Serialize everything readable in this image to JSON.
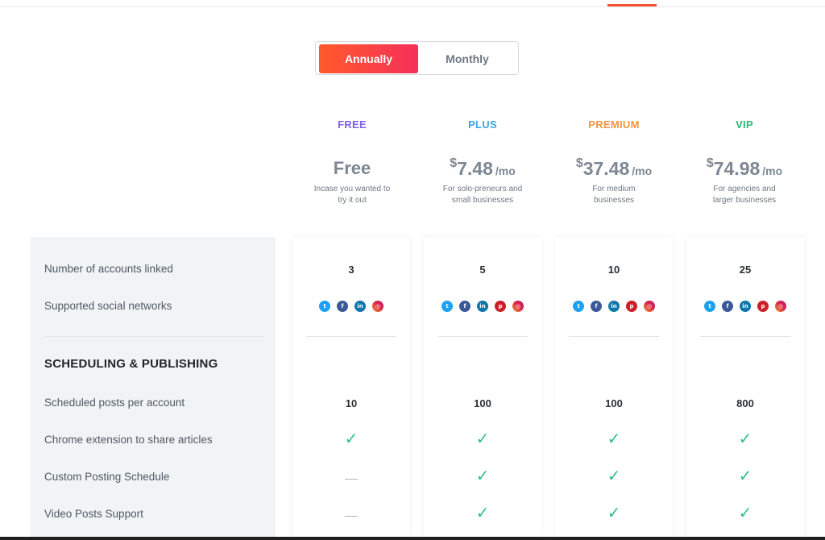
{
  "billing_toggle": {
    "annually": "Annually",
    "monthly": "Monthly",
    "selected": "Annually"
  },
  "colors": {
    "free": "#7b61e8",
    "plus": "#3aa6e8",
    "premium": "#f4943b",
    "vip": "#27bd74",
    "accent": "#f4502f",
    "check": "#2fbf8c"
  },
  "plans": [
    {
      "name": "FREE",
      "price_text": "Free",
      "description": [
        "Incase you wanted to",
        "try it out"
      ]
    },
    {
      "name": "PLUS",
      "currency": "$",
      "amount": "7.48",
      "per": "/mo",
      "description": [
        "For solo-preneurs and",
        "small businesses"
      ]
    },
    {
      "name": "PREMIUM",
      "currency": "$",
      "amount": "37.48",
      "per": "/mo",
      "description": [
        "For medium",
        "businesses"
      ]
    },
    {
      "name": "VIP",
      "currency": "$",
      "amount": "74.98",
      "per": "/mo",
      "description": [
        "For agencies and",
        "larger businesses"
      ]
    }
  ],
  "features": {
    "accounts_linked": {
      "label": "Number of accounts linked",
      "values": [
        "3",
        "5",
        "10",
        "25"
      ]
    },
    "social_networks": {
      "label": "Supported social networks",
      "icons": [
        [
          "twitter-icon",
          "facebook-icon",
          "linkedin-icon",
          "instagram-icon"
        ],
        [
          "twitter-icon",
          "facebook-icon",
          "linkedin-icon",
          "pinterest-icon",
          "instagram-icon"
        ],
        [
          "twitter-icon",
          "facebook-icon",
          "linkedin-icon",
          "pinterest-icon",
          "instagram-icon"
        ],
        [
          "twitter-icon",
          "facebook-icon",
          "linkedin-icon",
          "pinterest-icon",
          "instagram-icon"
        ]
      ]
    },
    "section_title": "SCHEDULING & PUBLISHING",
    "scheduled_posts": {
      "label": "Scheduled posts per account",
      "values": [
        "10",
        "100",
        "100",
        "800"
      ]
    },
    "chrome_extension": {
      "label": "Chrome extension to share articles",
      "values": [
        true,
        true,
        true,
        true
      ]
    },
    "custom_schedule": {
      "label": "Custom Posting Schedule",
      "values": [
        false,
        true,
        true,
        true
      ]
    },
    "video_posts": {
      "label": "Video Posts Support",
      "values": [
        false,
        true,
        true,
        true
      ]
    }
  }
}
